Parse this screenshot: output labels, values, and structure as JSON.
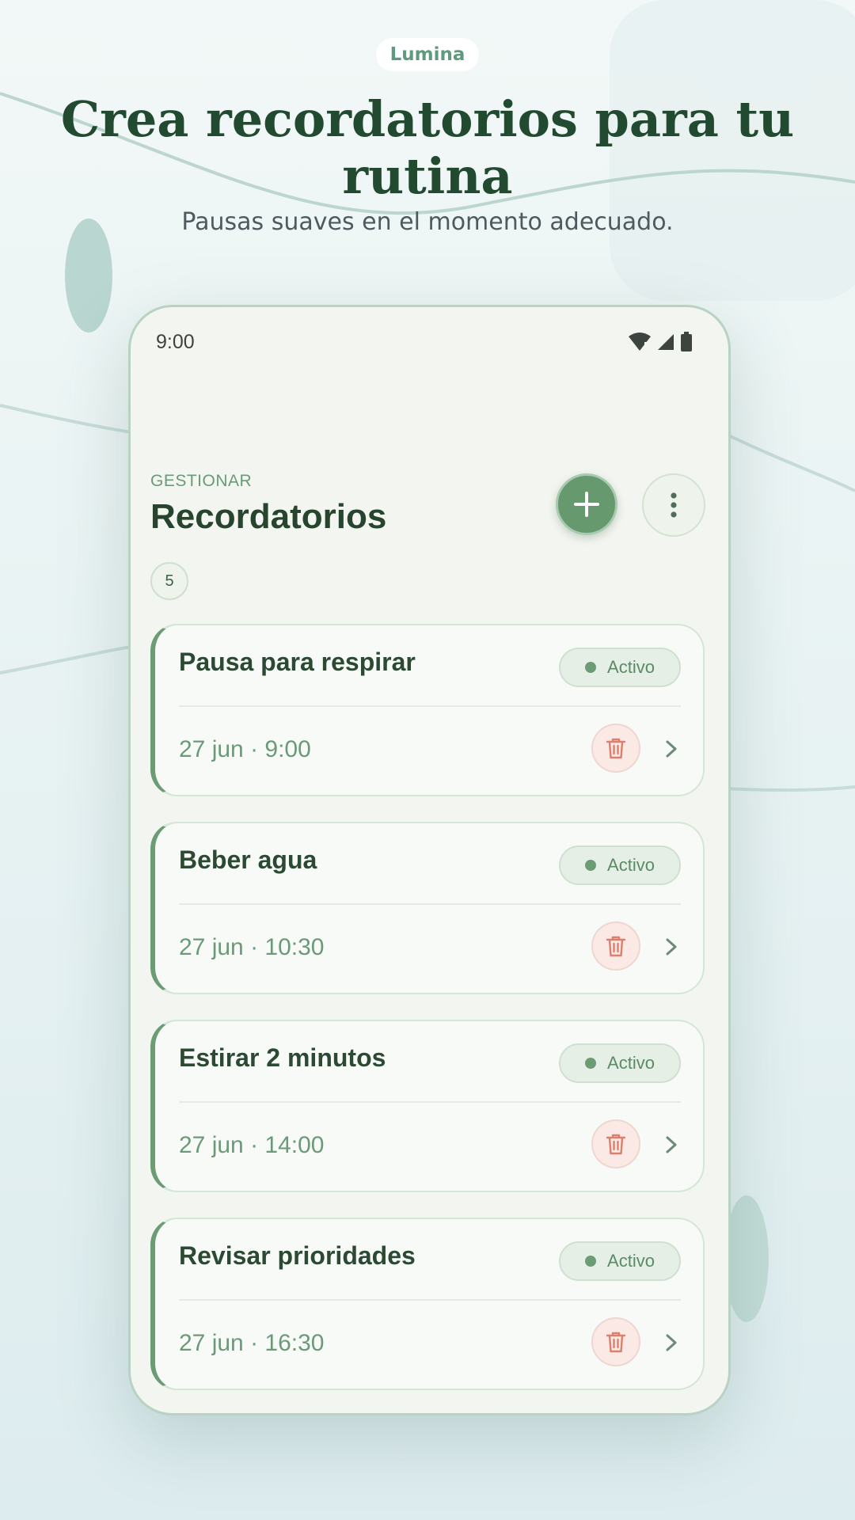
{
  "brand": {
    "name": "Lumina"
  },
  "hero": {
    "title": "Crea recordatorios para tu rutina",
    "subtitle": "Pausas suaves en el momento adecuado."
  },
  "status_bar": {
    "time": "9:00",
    "icons": [
      "wifi-icon",
      "signal-icon",
      "battery-icon"
    ]
  },
  "screen": {
    "eyebrow": "GESTIONAR",
    "title": "Recordatorios",
    "count": "5",
    "actions": [
      "add-icon",
      "more-vert-icon"
    ]
  },
  "reminders": [
    {
      "title": "Pausa para respirar",
      "status": "Activo",
      "datetime": "27 jun · 9:00"
    },
    {
      "title": "Beber agua",
      "status": "Activo",
      "datetime": "27 jun · 10:30"
    },
    {
      "title": "Estirar 2 minutos",
      "status": "Activo",
      "datetime": "27 jun · 14:00"
    },
    {
      "title": "Revisar prioridades",
      "status": "Activo",
      "datetime": "27 jun · 16:30"
    }
  ],
  "colors": {
    "primary": "#67996f",
    "title_text": "#224a30",
    "delete_accent": "#d9806e",
    "background": "#e9f3f3"
  }
}
